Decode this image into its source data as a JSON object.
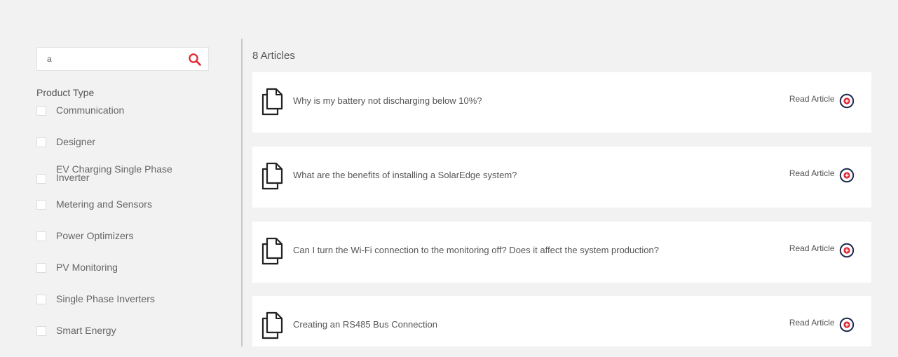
{
  "search": {
    "value": "a",
    "placeholder": ""
  },
  "filters": {
    "heading": "Product Type",
    "items": [
      {
        "label": "Communication"
      },
      {
        "label": "Designer"
      },
      {
        "label": "EV Charging Single Phase Inverter"
      },
      {
        "label": "Metering and Sensors"
      },
      {
        "label": "Power Optimizers"
      },
      {
        "label": "PV Monitoring"
      },
      {
        "label": "Single Phase Inverters"
      },
      {
        "label": "Smart Energy"
      }
    ]
  },
  "articles": {
    "count_label": "8 Articles",
    "read_label": "Read Article",
    "items": [
      {
        "title": "Why is my battery not discharging below 10%?"
      },
      {
        "title": "What are the benefits of installing a SolarEdge system?"
      },
      {
        "title": "Can I turn the Wi-Fi connection to the monitoring off? Does it affect the system production?"
      },
      {
        "title": "Creating an RS485 Bus Connection"
      }
    ]
  },
  "colors": {
    "accent": "#e5202e",
    "navy": "#1f2a4d",
    "background": "#f2f2f2"
  },
  "icons": {
    "search": "search-icon",
    "document": "document-icon",
    "read": "plus-circle-icon"
  }
}
